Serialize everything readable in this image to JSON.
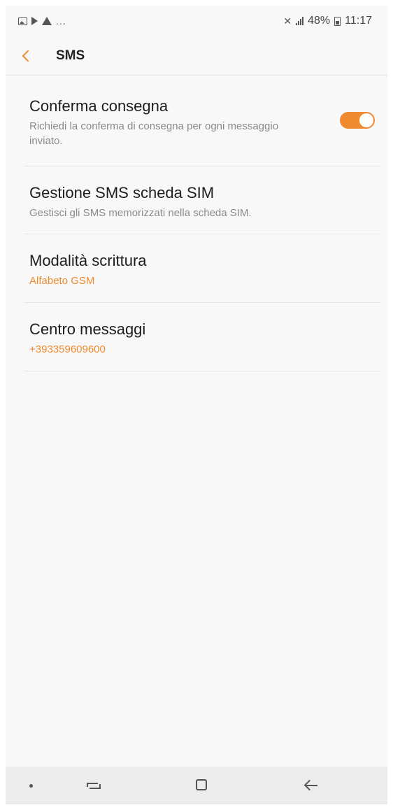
{
  "status_bar": {
    "dots": "...",
    "battery_percent": "48%",
    "time": "11:17",
    "icons": [
      "image-icon",
      "play-store-icon",
      "warning-icon",
      "mute-icon",
      "signal-icon",
      "battery-icon"
    ]
  },
  "header": {
    "title": "SMS",
    "back_icon": "chevron-left-icon"
  },
  "settings": [
    {
      "title": "Conferma consegna",
      "subtitle": "Richiedi la conferma di consegna per ogni messaggio inviato.",
      "toggle_on": true
    },
    {
      "title": "Gestione SMS scheda SIM",
      "subtitle": "Gestisci gli SMS memorizzati nella scheda SIM."
    },
    {
      "title": "Modalità scrittura",
      "value": "Alfabeto GSM"
    },
    {
      "title": "Centro messaggi",
      "value": "+393359609600"
    }
  ],
  "colors": {
    "accent": "#f08a2e",
    "background": "#f8f8f8",
    "nav_bar": "#ececec"
  },
  "nav_bar": {
    "icons": [
      "dot-icon",
      "recent-apps-icon",
      "home-icon",
      "back-arrow-icon"
    ]
  }
}
